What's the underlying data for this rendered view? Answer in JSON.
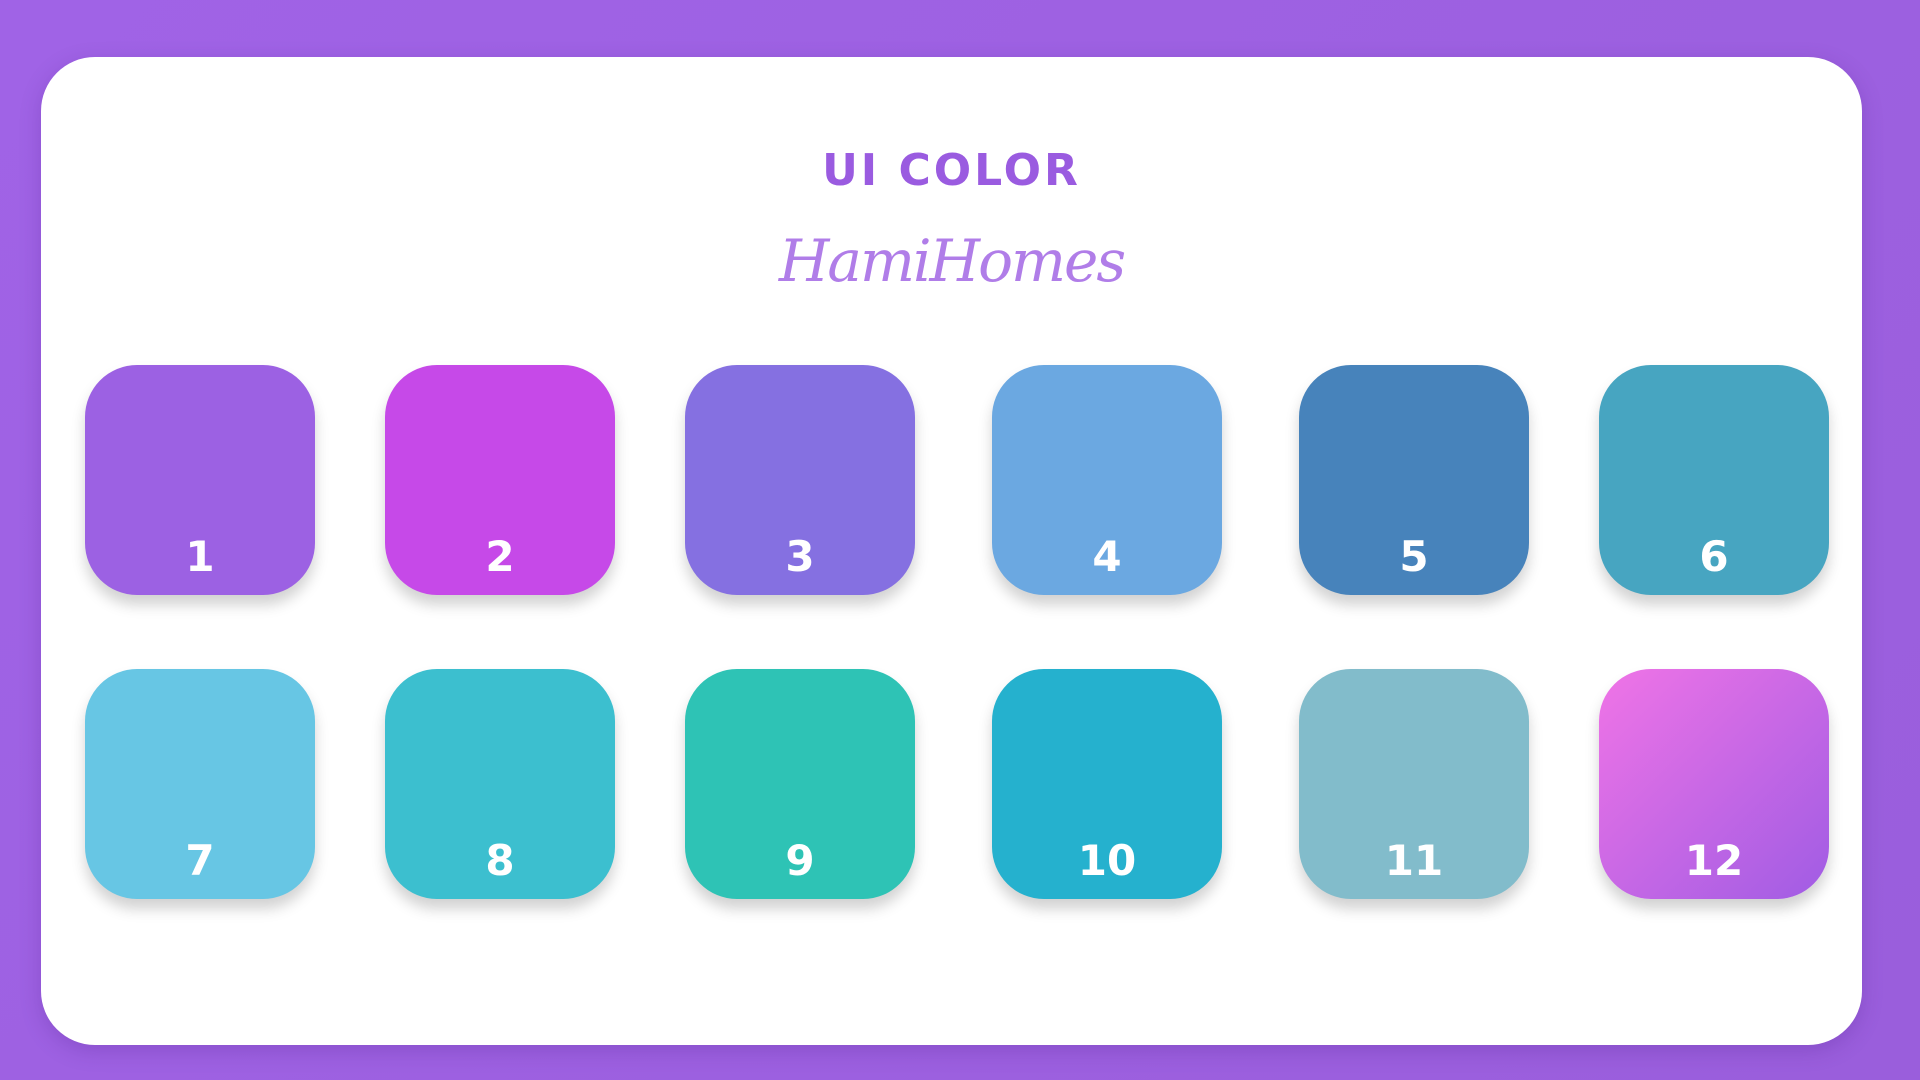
{
  "header": {
    "title": "UI COLOR",
    "brand": "HamiHomes"
  },
  "swatches": [
    {
      "label": "1",
      "color": "#9c61e3"
    },
    {
      "label": "2",
      "color": "#c649e8"
    },
    {
      "label": "3",
      "color": "#8570e1"
    },
    {
      "label": "4",
      "color": "#6ba8e1"
    },
    {
      "label": "5",
      "color": "#4783bb"
    },
    {
      "label": "6",
      "color": "#47a5c1"
    },
    {
      "label": "7",
      "color": "#67c6e4"
    },
    {
      "label": "8",
      "color": "#3cbfcf"
    },
    {
      "label": "9",
      "color": "#2ec3b5"
    },
    {
      "label": "10",
      "color": "#25b1ce"
    },
    {
      "label": "11",
      "color": "#82bccb"
    },
    {
      "label": "12",
      "color_start": "#f074e6",
      "color_end": "#a05ce4"
    }
  ]
}
